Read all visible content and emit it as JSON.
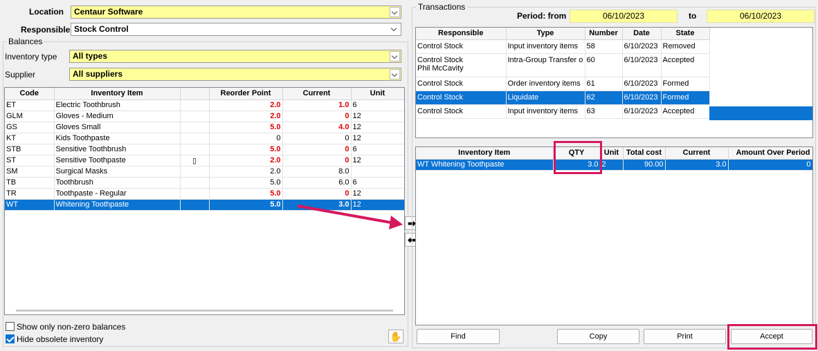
{
  "filters": {
    "location_label": "Location",
    "location_value": "Centaur Software",
    "responsible_label": "Responsible",
    "responsible_value": "Stock  Control",
    "balances_title": "Balances",
    "inventory_type_label": "Inventory type",
    "inventory_type_value": "All types",
    "supplier_label": "Supplier",
    "supplier_value": "All suppliers"
  },
  "balances": {
    "headers": [
      "Code",
      "Inventory Item",
      "",
      "Reorder Point",
      "Current",
      "Unit"
    ],
    "rows": [
      {
        "code": "ET",
        "item": "Electric Toothbrush",
        "flag": "",
        "reorder": "2.0",
        "current": "1.0",
        "unit": "6",
        "red": true,
        "selected": false
      },
      {
        "code": "GLM",
        "item": "Gloves - Medium",
        "flag": "",
        "reorder": "2.0",
        "current": "0",
        "unit": "12",
        "red": true,
        "selected": false
      },
      {
        "code": "GS",
        "item": "Gloves Small",
        "flag": "",
        "reorder": "5.0",
        "current": "4.0",
        "unit": "12",
        "red": true,
        "selected": false
      },
      {
        "code": "KT",
        "item": "Kids Toothpaste",
        "flag": "",
        "reorder": "0",
        "current": "0",
        "unit": "12",
        "red": false,
        "selected": false
      },
      {
        "code": "STB",
        "item": "Sensitive Toothbrush",
        "flag": "",
        "reorder": "5.0",
        "current": "0",
        "unit": "6",
        "red": true,
        "selected": false
      },
      {
        "code": "ST",
        "item": "Sensitive Toothpaste",
        "flag": "▯",
        "reorder": "2.0",
        "current": "0",
        "unit": "12",
        "red": true,
        "selected": false
      },
      {
        "code": "SM",
        "item": "Surgical Masks",
        "flag": "",
        "reorder": "2.0",
        "current": "8.0",
        "unit": "",
        "red": false,
        "selected": false
      },
      {
        "code": "TB",
        "item": "Toothbrush",
        "flag": "",
        "reorder": "5.0",
        "current": "6.0",
        "unit": "6",
        "red": false,
        "selected": false
      },
      {
        "code": "TR",
        "item": "Toothpaste - Regular",
        "flag": "",
        "reorder": "5.0",
        "current": "0",
        "unit": "12",
        "red": true,
        "selected": false
      },
      {
        "code": "WT",
        "item": "Whitening Toothpaste",
        "flag": "",
        "reorder": "5.0",
        "current": "3.0",
        "unit": "12",
        "red": true,
        "selected": true
      }
    ]
  },
  "options": {
    "non_zero_label": "Show only non-zero balances",
    "non_zero_checked": false,
    "hide_obsolete_label": "Hide obsolete inventory",
    "hide_obsolete_checked": true
  },
  "transactions": {
    "title": "Transactions",
    "period_from_label": "Period: from",
    "period_from": "06/10/2023",
    "period_to_label": "to",
    "period_to": "06/10/2023",
    "headers": [
      "Responsible",
      "Type",
      "Number",
      "Date",
      "State"
    ],
    "rows": [
      {
        "responsible": "Control  Stock",
        "responsible2": "",
        "type": "Input inventory items",
        "number": "58",
        "date": "6/10/2023",
        "state": "Removed",
        "selected": false
      },
      {
        "responsible": "Control  Stock",
        "responsible2": "Phil  McCavity",
        "type": "Intra-Group Transfer o",
        "number": "60",
        "date": "6/10/2023",
        "state": "Accepted",
        "selected": false
      },
      {
        "responsible": "Control  Stock",
        "responsible2": "",
        "type": "Order inventory items",
        "number": "61",
        "date": "6/10/2023",
        "state": "Formed",
        "selected": false
      },
      {
        "responsible": "Control  Stock",
        "responsible2": "",
        "type": "Liquidate",
        "number": "62",
        "date": "6/10/2023",
        "state": "Formed",
        "selected": true
      },
      {
        "responsible": "Control  Stock",
        "responsible2": "",
        "type": "Input inventory items",
        "number": "63",
        "date": "6/10/2023",
        "state": "Accepted",
        "selected": false
      }
    ]
  },
  "details": {
    "headers": [
      "Inventory Item",
      "QTY",
      "Unit",
      "Total cost",
      "Current",
      "Amount Over Period"
    ],
    "rows": [
      {
        "item": "WT Whitening Toothpaste",
        "qty": "3.0",
        "unit": "2",
        "total": "90.00",
        "current": "3.0",
        "amount": "0",
        "selected": true
      }
    ]
  },
  "buttons": {
    "find": "Find",
    "copy": "Copy",
    "print": "Print",
    "accept": "Accept"
  },
  "colors": {
    "highlight": "#d6185d",
    "selection": "#0c74d3",
    "field_yellow": "#ffff99",
    "alert_red": "#e00000"
  }
}
